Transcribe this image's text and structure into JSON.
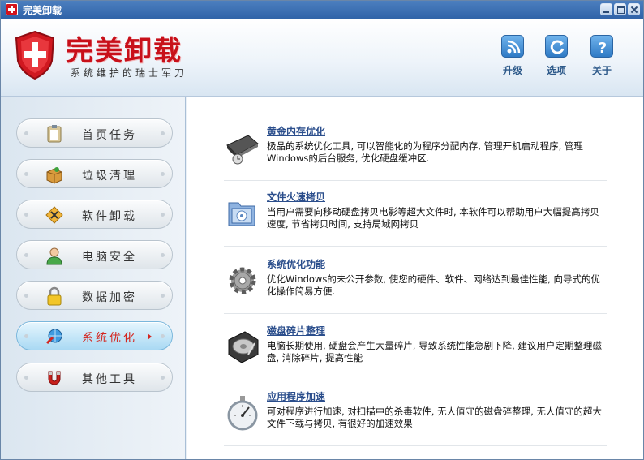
{
  "window": {
    "title": "完美卸载"
  },
  "header": {
    "brand": "完美卸载",
    "slogan": "系统维护的瑞士军刀",
    "actions": [
      {
        "label": "升级",
        "icon": "rss-icon"
      },
      {
        "label": "选项",
        "icon": "refresh-icon"
      },
      {
        "label": "关于",
        "icon": "help-icon"
      }
    ]
  },
  "sidebar": {
    "items": [
      {
        "label": "首页任务",
        "icon": "clipboard-icon",
        "active": false
      },
      {
        "label": "垃圾清理",
        "icon": "box-icon",
        "active": false
      },
      {
        "label": "软件卸载",
        "icon": "tools-icon",
        "active": false
      },
      {
        "label": "电脑安全",
        "icon": "user-shield-icon",
        "active": false
      },
      {
        "label": "数据加密",
        "icon": "lock-icon",
        "active": false
      },
      {
        "label": "系统优化",
        "icon": "globe-tool-icon",
        "active": true
      },
      {
        "label": "其他工具",
        "icon": "magnet-icon",
        "active": false
      }
    ]
  },
  "content": {
    "items": [
      {
        "title": "黄金内存优化",
        "icon": "memory-chip-icon",
        "desc": "极品的系统优化工具, 可以智能化的为程序分配内存, 管理开机启动程序, 管理Windows的后台服务, 优化硬盘缓冲区."
      },
      {
        "title": "文件火速拷贝",
        "icon": "folder-copy-icon",
        "desc": "当用户需要向移动硬盘拷贝电影等超大文件时, 本软件可以帮助用户大幅提高拷贝速度, 节省拷贝时间, 支持局域网拷贝"
      },
      {
        "title": "系统优化功能",
        "icon": "gear-icon",
        "desc": "优化Windows的未公开参数, 使您的硬件、软件、网络达到最佳性能, 向导式的优化操作简易方便."
      },
      {
        "title": "磁盘碎片整理",
        "icon": "hard-disk-icon",
        "desc": "电脑长期使用, 硬盘会产生大量碎片, 导致系统性能急剧下降, 建议用户定期整理磁盘, 消除碎片, 提高性能"
      },
      {
        "title": "应用程序加速",
        "icon": "gauge-icon",
        "desc": "可对程序进行加速, 对扫描中的杀毒软件, 无人值守的磁盘碎整理, 无人值守的超大文件下载与拷贝, 有很好的加速效果"
      }
    ]
  },
  "colors": {
    "brand_red": "#c8101a",
    "link_blue": "#2b4e8c",
    "active_label": "#d4261f"
  }
}
